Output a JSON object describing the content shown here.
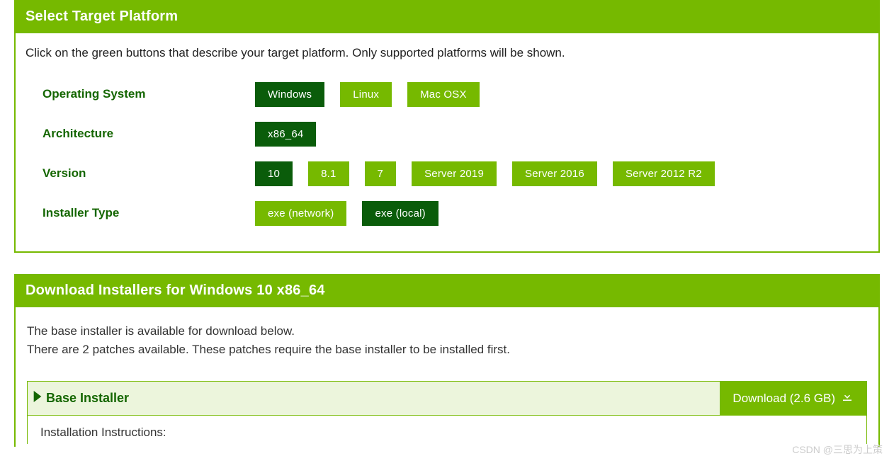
{
  "select": {
    "title": "Select Target Platform",
    "intro": "Click on the green buttons that describe your target platform. Only supported platforms will be shown.",
    "rows": {
      "os": {
        "label": "Operating System",
        "options": [
          {
            "label": "Windows",
            "selected": true
          },
          {
            "label": "Linux",
            "selected": false
          },
          {
            "label": "Mac OSX",
            "selected": false
          }
        ]
      },
      "arch": {
        "label": "Architecture",
        "options": [
          {
            "label": "x86_64",
            "selected": true
          }
        ]
      },
      "version": {
        "label": "Version",
        "options": [
          {
            "label": "10",
            "selected": true
          },
          {
            "label": "8.1",
            "selected": false
          },
          {
            "label": "7",
            "selected": false
          },
          {
            "label": "Server 2019",
            "selected": false
          },
          {
            "label": "Server 2016",
            "selected": false
          },
          {
            "label": "Server 2012 R2",
            "selected": false
          }
        ]
      },
      "installer": {
        "label": "Installer Type",
        "options": [
          {
            "label": "exe (network)",
            "selected": false
          },
          {
            "label": "exe (local)",
            "selected": true
          }
        ]
      }
    }
  },
  "download": {
    "title": "Download Installers for Windows 10 x86_64",
    "line1": "The base installer is available for download below.",
    "line2": "There are 2 patches available. These patches require the base installer to be installed first.",
    "base": {
      "title": "Base Installer",
      "button": "Download (2.6 GB)",
      "instructions_label": "Installation Instructions:"
    }
  },
  "watermark": "CSDN @三思为上策"
}
